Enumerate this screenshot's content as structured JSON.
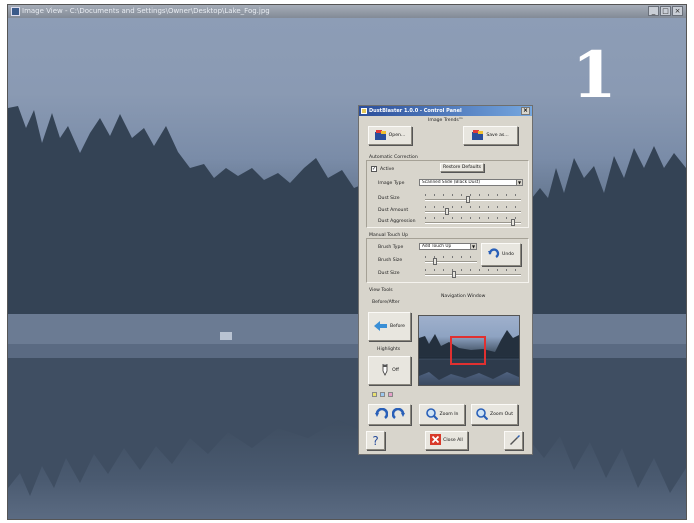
{
  "viewer": {
    "title": "Image View - C:\\Documents and Settings\\Owner\\Desktop\\Lake_Fog.jpg",
    "controls": [
      "_",
      "□",
      "×"
    ]
  },
  "frame_number": "1",
  "panel": {
    "title": "DustBlaster 1.0.0 - Control Panel",
    "close_label": "×",
    "image_trends": {
      "heading": "Image Trends™",
      "open_label": "Open...",
      "save_label": "Save as..."
    },
    "auto_correction": {
      "heading": "Automatic Correction",
      "active_label": "Active",
      "active_checked": true,
      "restore_label": "Restore Defaults",
      "image_type_label": "Image Type",
      "image_type_value": "Scanned Slide (Black Dust)",
      "dust_size_label": "Dust Size",
      "dust_size_level": 0.45,
      "dust_amount_label": "Dust Amount",
      "dust_amount_level": 0.2,
      "dust_aggression_label": "Dust Aggression",
      "dust_aggression_level": 0.9
    },
    "manual_touch_up": {
      "heading": "Manual Touch Up",
      "brush_type_label": "Brush Type",
      "brush_type_value": "Add Touch Up",
      "brush_size_label": "Brush Size",
      "brush_size_level": 0.15,
      "dust_size_label": "Dust Size",
      "dust_size_level": 0.3,
      "undo_label": "Undo"
    },
    "view_tools": {
      "heading": "View Tools",
      "navigation_label": "Navigation Window",
      "before_after_label": "Before/After",
      "before_label": "Before",
      "highlights_label": "Highlights",
      "off_label": "Off",
      "zoom_in_label": "Zoom In",
      "zoom_out_label": "Zoom Out",
      "help_label": "?",
      "close_all_label": "Close All",
      "swatch_colors": [
        "#e8e070",
        "#9cc8ef",
        "#e6a0c8"
      ]
    }
  }
}
